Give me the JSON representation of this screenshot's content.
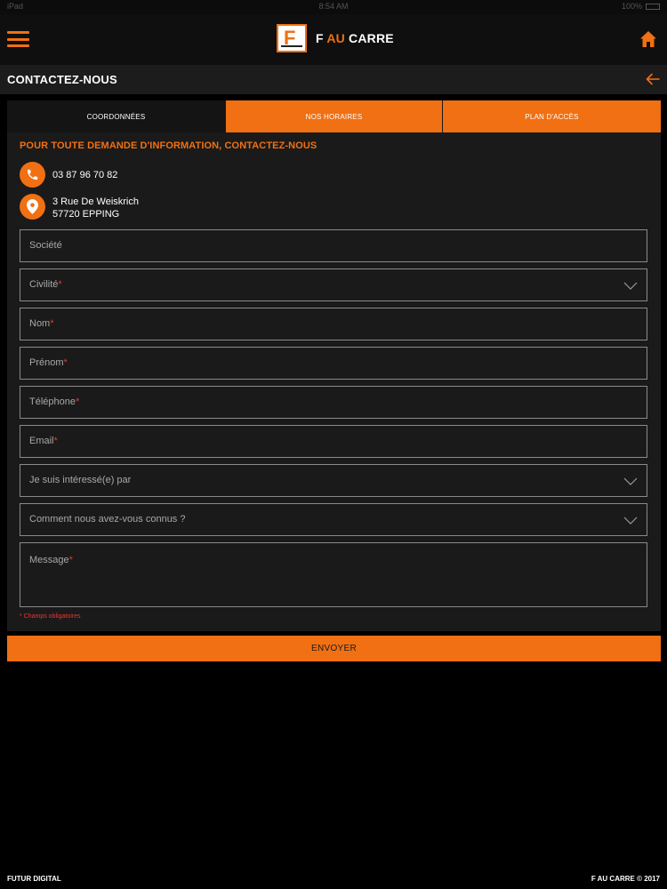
{
  "colors": {
    "accent": "#f07013",
    "background": "#000000",
    "card": "#1a1a1a",
    "required": "#e53935"
  },
  "status_bar": {
    "carrier": "iPad",
    "time": "8:54 AM",
    "battery": "100%"
  },
  "header": {
    "menu_icon": "hamburger-menu-icon",
    "logo_prefix": "F ",
    "logo_accent": "AU",
    "logo_suffix": " CARRE",
    "home_icon": "home-icon"
  },
  "page": {
    "title": "CONTACTEZ-NOUS",
    "back_icon": "arrow-left-icon"
  },
  "tabs": [
    {
      "label": "COORDONNÉES",
      "active": true
    },
    {
      "label": "NOS HORAIRES",
      "active": false
    },
    {
      "label": "PLAN D'ACCÈS",
      "active": false
    }
  ],
  "contact": {
    "heading": "POUR TOUTE DEMANDE D'INFORMATION, CONTACTEZ-NOUS",
    "phone": "03 87 96 70 82",
    "phone_icon": "phone-icon",
    "address_line1": "3 Rue De Weiskrich",
    "address_line2": "57720 EPPING",
    "address_icon": "location-pin-icon"
  },
  "form": {
    "societe": {
      "placeholder": "Société",
      "required": ""
    },
    "civilite": {
      "placeholder": "Civilité",
      "required": "*"
    },
    "nom": {
      "placeholder": "Nom",
      "required": "*"
    },
    "prenom": {
      "placeholder": "Prénom",
      "required": "*"
    },
    "telephone": {
      "placeholder": "Téléphone",
      "required": "*"
    },
    "email": {
      "placeholder": "Email",
      "required": "*"
    },
    "interesse": {
      "placeholder": "Je suis intéressé(e) par",
      "required": ""
    },
    "connus": {
      "placeholder": "Comment nous avez-vous connus ?",
      "required": ""
    },
    "message": {
      "placeholder": "Message",
      "required": "*"
    },
    "required_note": "* Champs obligatoires",
    "submit_label": "ENVOYER"
  },
  "footer": {
    "left": "FUTUR DIGITAL",
    "right": "F AU CARRE © 2017"
  }
}
